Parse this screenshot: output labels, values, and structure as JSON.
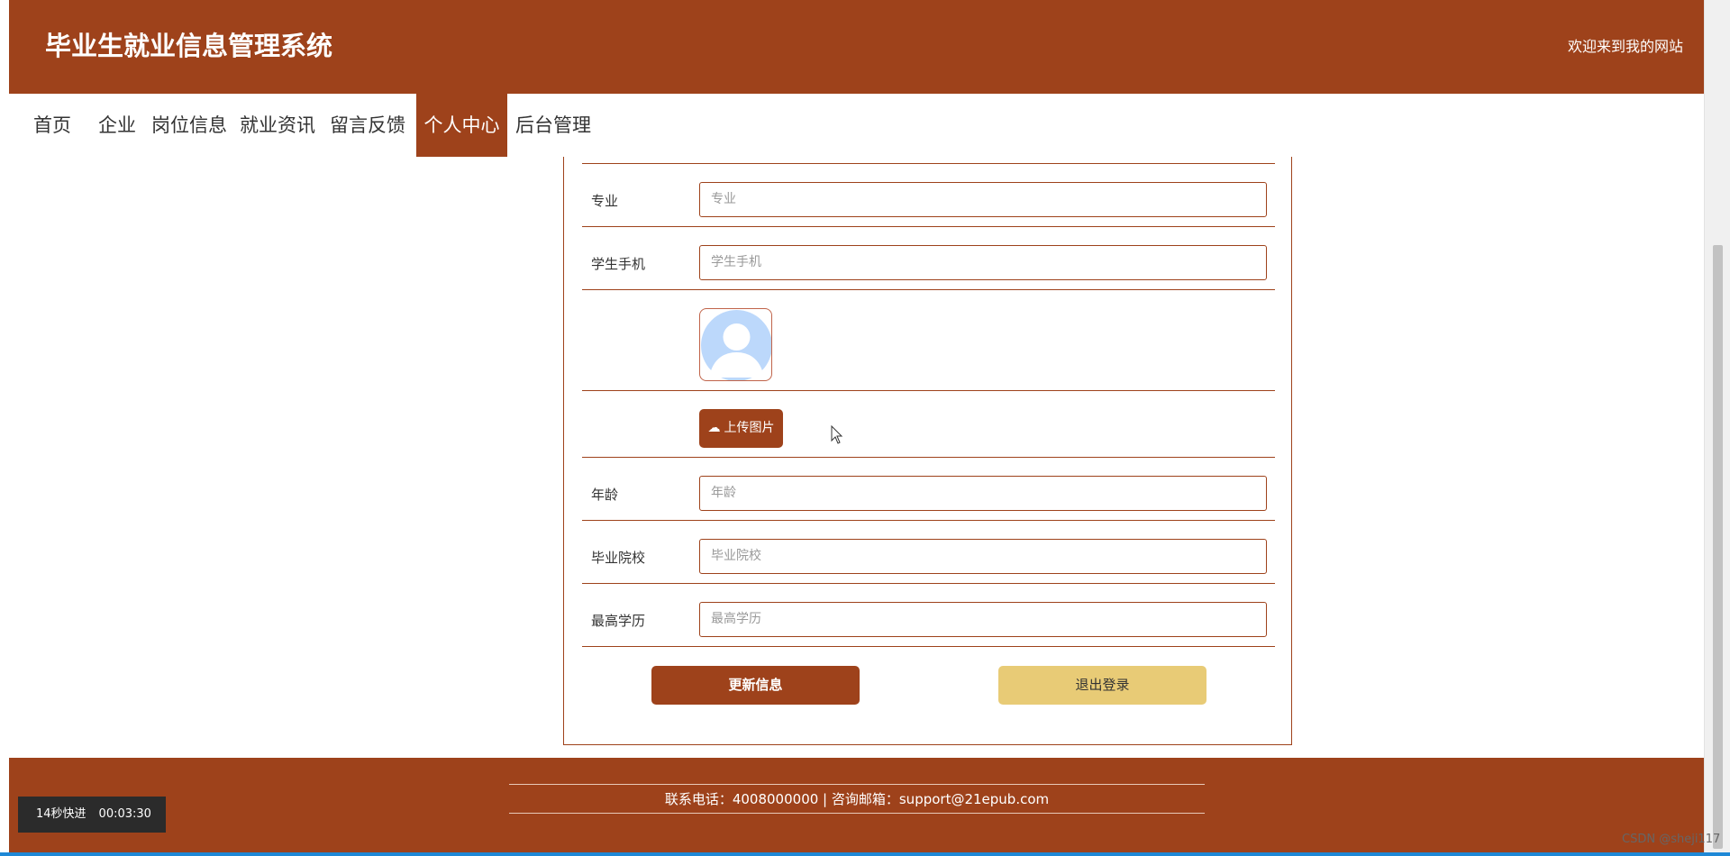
{
  "header": {
    "title": "毕业生就业信息管理系统",
    "welcome": "欢迎来到我的网站"
  },
  "nav": {
    "items": [
      {
        "label": "首页"
      },
      {
        "label": "企业"
      },
      {
        "label": "岗位信息"
      },
      {
        "label": "就业资讯"
      },
      {
        "label": "留言反馈"
      },
      {
        "label": "个人中心",
        "active": true
      },
      {
        "label": "后台管理"
      }
    ]
  },
  "form": {
    "major": {
      "label": "专业",
      "placeholder": "专业",
      "value": ""
    },
    "phone": {
      "label": "学生手机",
      "placeholder": "学生手机",
      "value": ""
    },
    "photo": {
      "upload_label": "上传图片",
      "icon": "cloud-upload-icon",
      "avatar_icon": "default-user-avatar"
    },
    "age": {
      "label": "年龄",
      "placeholder": "年龄",
      "value": ""
    },
    "school": {
      "label": "毕业院校",
      "placeholder": "毕业院校",
      "value": ""
    },
    "education": {
      "label": "最高学历",
      "placeholder": "最高学历",
      "value": ""
    },
    "update_label": "更新信息",
    "logout_label": "退出登录"
  },
  "footer": {
    "contact": "联系电话：4008000000 | 咨询邮箱：support@21epub.com"
  },
  "overlay": {
    "fast_forward": "14秒快进",
    "time": "00:03:30",
    "watermark": "CSDN @sheji117"
  },
  "colors": {
    "brand": "#9e421b",
    "logout_button": "#e8cb76",
    "progress": "#1e88d6"
  }
}
